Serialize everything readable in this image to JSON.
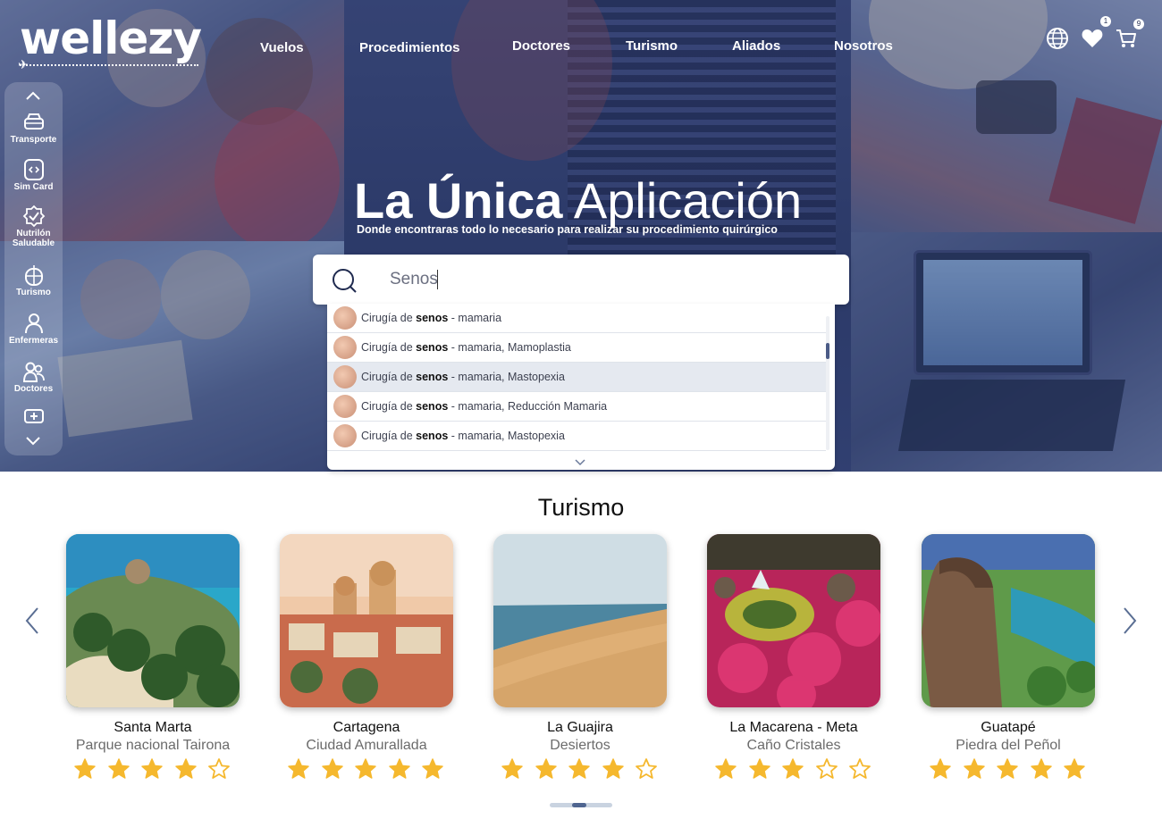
{
  "brand": {
    "logo_text": "wellezy"
  },
  "nav": {
    "items": [
      "Vuelos",
      "Procedimientos",
      "Doctores",
      "Turismo",
      "Aliados",
      "Nosotros"
    ]
  },
  "header_icons": {
    "globe": "globe-icon",
    "favorites": "heart-icon",
    "favorites_count": "1",
    "cart": "cart-icon",
    "cart_count": "9"
  },
  "sidebar": {
    "items": [
      {
        "label": "Transporte",
        "icon": "car-icon"
      },
      {
        "label": "Sim Card",
        "icon": "sim-card-icon"
      },
      {
        "label": "Nutrilón Saludable",
        "icon": "badge-check-icon"
      },
      {
        "label": "Turismo",
        "icon": "suitcase-icon"
      },
      {
        "label": "Enfermeras",
        "icon": "nurse-icon"
      },
      {
        "label": "Doctores",
        "icon": "doctors-icon"
      },
      {
        "label": "",
        "icon": "medical-kit-icon"
      }
    ]
  },
  "hero": {
    "title_bold": "La Única",
    "title_light": "Aplicación",
    "subtitle": "Donde encontraras todo lo necesario para realizar su procedimiento quirúrgico"
  },
  "search": {
    "value": "Senos",
    "suggestions": [
      {
        "prefix": "Cirugía de ",
        "match": "senos",
        "suffix": " - mamaria"
      },
      {
        "prefix": "Cirugía de ",
        "match": "senos",
        "suffix": " - mamaria, Mamoplastia"
      },
      {
        "prefix": "Cirugía de ",
        "match": "senos",
        "suffix": " - mamaria, Mastopexia"
      },
      {
        "prefix": "Cirugía de ",
        "match": "senos",
        "suffix": " - mamaria, Reducción Mamaria"
      },
      {
        "prefix": "Cirugía de ",
        "match": "senos",
        "suffix": " - mamaria, Mastopexia"
      }
    ],
    "highlighted_index": 2
  },
  "tourism": {
    "title": "Turismo",
    "cards": [
      {
        "name": "Santa Marta",
        "subtitle": "Parque nacional Tairona",
        "rating": 4
      },
      {
        "name": "Cartagena",
        "subtitle": "Ciudad Amurallada",
        "rating": 5
      },
      {
        "name": "La Guajira",
        "subtitle": "Desiertos",
        "rating": 4
      },
      {
        "name": "La Macarena - Meta",
        "subtitle": "Caño Cristales",
        "rating": 3
      },
      {
        "name": "Guatapé",
        "subtitle": "Piedra del Peñol",
        "rating": 5
      }
    ],
    "page_indicator": {
      "current": 2,
      "total": 5
    }
  },
  "colors": {
    "star_filled": "#f5b82e",
    "star_empty_stroke": "#f5b82e",
    "accent": "#1f2a4f",
    "hero_overlay": "#283870"
  }
}
